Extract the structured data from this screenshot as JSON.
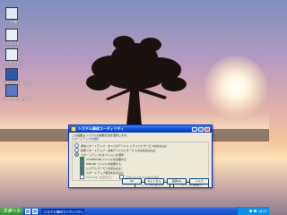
{
  "desktop": {
    "icons": [
      {
        "label": "ごみ箱",
        "icon": "recycle-bin-icon"
      },
      {
        "label": "Acrobat 8.0",
        "icon": "acrobat-icon"
      },
      {
        "label": "Acrobat 8.0",
        "icon": "acrobat-icon"
      },
      {
        "label": "PowerShell Menu",
        "icon": "powershell-icon"
      },
      {
        "label": "PowerToys for XP",
        "icon": "powertoys-icon"
      }
    ]
  },
  "window": {
    "title": "システム構成ユーティリティ",
    "description": "この画面は システムの起動方法を選択します。",
    "startup_label": "スタートアップの選択",
    "radios": [
      {
        "label": "通常スタートアップ - すべてのデバイス ドライバとサービスを読み込む",
        "selected": false
      },
      {
        "label": "診断スタートアップ - 基本デバイスとサービスのみを読み込む",
        "selected": false
      },
      {
        "label": "スタートアップのオプションを選択",
        "selected": true
      }
    ],
    "checkboxes": [
      {
        "label": "SYSTEM.INI ファイルを処理する",
        "checked": true
      },
      {
        "label": "WIN.INI ファイルを処理する",
        "checked": true
      },
      {
        "label": "システム サービスを読み込む",
        "checked": true
      },
      {
        "label": "スタートアップ項目を読み込む",
        "checked": true
      },
      {
        "label": "BOOT.INI を使用する",
        "checked": false
      },
      {
        "label": "変更されたBOOT.INIを使用",
        "checked": false
      }
    ],
    "buttons": {
      "restore": "システムの復元(S)",
      "expand": "ファイルの展開(E)",
      "ok": "OK",
      "cancel": "キャンセル",
      "apply": "適用(A)",
      "help": "ヘルプ"
    }
  },
  "taskbar": {
    "start_label": "スタート",
    "task_item": "システム構成ユーティリティ",
    "clock": "18:07"
  }
}
